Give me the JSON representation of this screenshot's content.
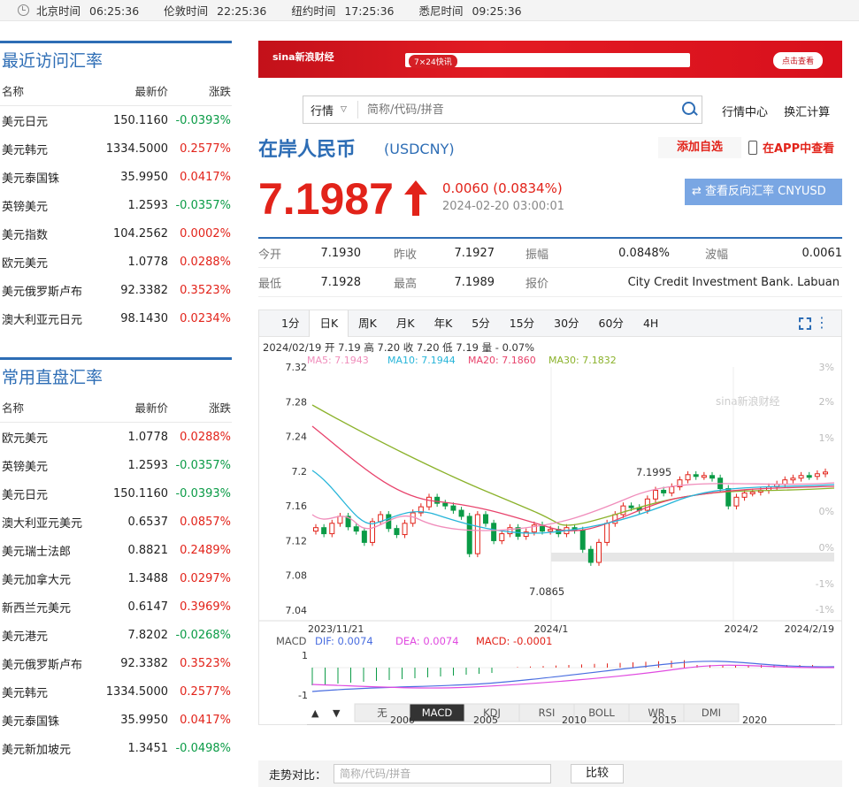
{
  "timezones": [
    {
      "label": "北京时间",
      "time": "06:25:36"
    },
    {
      "label": "伦敦时间",
      "time": "22:25:36"
    },
    {
      "label": "纽约时间",
      "time": "17:25:36"
    },
    {
      "label": "悉尼时间",
      "time": "09:25:36"
    }
  ],
  "recent": {
    "title": "最近访问汇率",
    "cols": [
      "名称",
      "最新价",
      "涨跌"
    ],
    "rows": [
      {
        "name": "美元日元",
        "price": "150.1160",
        "chg": "-0.0393%"
      },
      {
        "name": "美元韩元",
        "price": "1334.5000",
        "chg": "0.2577%"
      },
      {
        "name": "美元泰国铢",
        "price": "35.9950",
        "chg": "0.0417%"
      },
      {
        "name": "英镑美元",
        "price": "1.2593",
        "chg": "-0.0357%"
      },
      {
        "name": "美元指数",
        "price": "104.2562",
        "chg": "0.0002%"
      },
      {
        "name": "欧元美元",
        "price": "1.0778",
        "chg": "0.0288%"
      },
      {
        "name": "美元俄罗斯卢布",
        "price": "92.3382",
        "chg": "0.3523%"
      },
      {
        "name": "澳大利亚元日元",
        "price": "98.1430",
        "chg": "0.0234%"
      }
    ]
  },
  "common": {
    "title": "常用直盘汇率",
    "cols": [
      "名称",
      "最新价",
      "涨跌"
    ],
    "rows": [
      {
        "name": "欧元美元",
        "price": "1.0778",
        "chg": "0.0288%"
      },
      {
        "name": "英镑美元",
        "price": "1.2593",
        "chg": "-0.0357%"
      },
      {
        "name": "美元日元",
        "price": "150.1160",
        "chg": "-0.0393%"
      },
      {
        "name": "澳大利亚元美元",
        "price": "0.6537",
        "chg": "0.0857%"
      },
      {
        "name": "美元瑞士法郎",
        "price": "0.8821",
        "chg": "0.2489%"
      },
      {
        "name": "美元加拿大元",
        "price": "1.3488",
        "chg": "0.0297%"
      },
      {
        "name": "新西兰元美元",
        "price": "0.6147",
        "chg": "0.3969%"
      },
      {
        "name": "美元港元",
        "price": "7.8202",
        "chg": "-0.0268%"
      },
      {
        "name": "美元俄罗斯卢布",
        "price": "92.3382",
        "chg": "0.3523%"
      },
      {
        "name": "美元韩元",
        "price": "1334.5000",
        "chg": "0.2577%"
      },
      {
        "name": "美元泰国铢",
        "price": "35.9950",
        "chg": "0.0417%"
      },
      {
        "name": "美元新加坡元",
        "price": "1.3451",
        "chg": "-0.0498%"
      }
    ]
  },
  "banner": {
    "logo": "sina新浪财经",
    "pill": "7×24快讯",
    "button": "点击查看"
  },
  "search": {
    "select": "行情",
    "placeholder": "简称/代码/拼音"
  },
  "links": [
    "行情中心",
    "换汇计算"
  ],
  "quote": {
    "name": "在岸人民币",
    "code": "(USDCNY)",
    "add": "添加自选",
    "app": "在APP中查看",
    "price": "7.1987",
    "change": "0.0060 (0.0834%)",
    "timestamp": "2024-02-20 03:00:01",
    "reverse": "⇄ 查看反向汇率 CNYUSD"
  },
  "stats": [
    [
      {
        "k": "今开",
        "v": "7.1930"
      },
      {
        "k": "昨收",
        "v": "7.1927"
      },
      {
        "k": "振幅",
        "v": "0.0848%"
      },
      {
        "k": "波幅",
        "v": "0.0061"
      }
    ],
    [
      {
        "k": "最低",
        "v": "7.1928"
      },
      {
        "k": "最高",
        "v": "7.1989"
      },
      {
        "k": "报价",
        "v": "City Credit Investment Bank. Labuan"
      }
    ]
  ],
  "chart_tabs": [
    "1分",
    "日K",
    "周K",
    "月K",
    "年K",
    "5分",
    "15分",
    "30分",
    "60分",
    "4H"
  ],
  "active_tab": "日K",
  "chart_info": {
    "line1": "2024/02/19 开 7.19 高 7.20 收 7.20 低 7.19 量 - 0.07%",
    "ma": [
      {
        "label": "MA5: 7.1943",
        "color": "#f08dbb"
      },
      {
        "label": "MA10: 7.1944",
        "color": "#27b5d9"
      },
      {
        "label": "MA20: 7.1860",
        "color": "#e8426b"
      },
      {
        "label": "MA30: 7.1832",
        "color": "#8bb22b"
      }
    ],
    "watermark": "sina新浪财经",
    "y_left": [
      "7.32",
      "7.28",
      "7.24",
      "7.2",
      "7.16",
      "7.12",
      "7.08",
      "7.04"
    ],
    "y_right": [
      "3%",
      "2%",
      "1%",
      "0%",
      "0%",
      "-1%",
      "-1%"
    ],
    "x_labels": [
      "2023/11/21",
      "2024/1",
      "2024/2",
      "2024/2/19"
    ],
    "high_label": "7.1995",
    "low_label": "7.0865",
    "macd": {
      "title": "MACD",
      "dif": "DIF: 0.0074",
      "dea": "DEA: 0.0074",
      "macd": "MACD: -0.0001",
      "y": [
        "1",
        "-1"
      ]
    },
    "indicator_tabs": [
      "无",
      "MACD",
      "KDJ",
      "RSI",
      "BOLL",
      "WR",
      "DMI"
    ],
    "active_indicator": "MACD",
    "nav_years": [
      "2000",
      "2005",
      "2010",
      "2015",
      "2020"
    ]
  },
  "compare": {
    "label": "走势对比：",
    "placeholder": "简称/代码/拼音",
    "button": "比较"
  },
  "colors": {
    "up": "#e2231a",
    "down": "#0a9b46",
    "brand": "#2d6db5"
  }
}
